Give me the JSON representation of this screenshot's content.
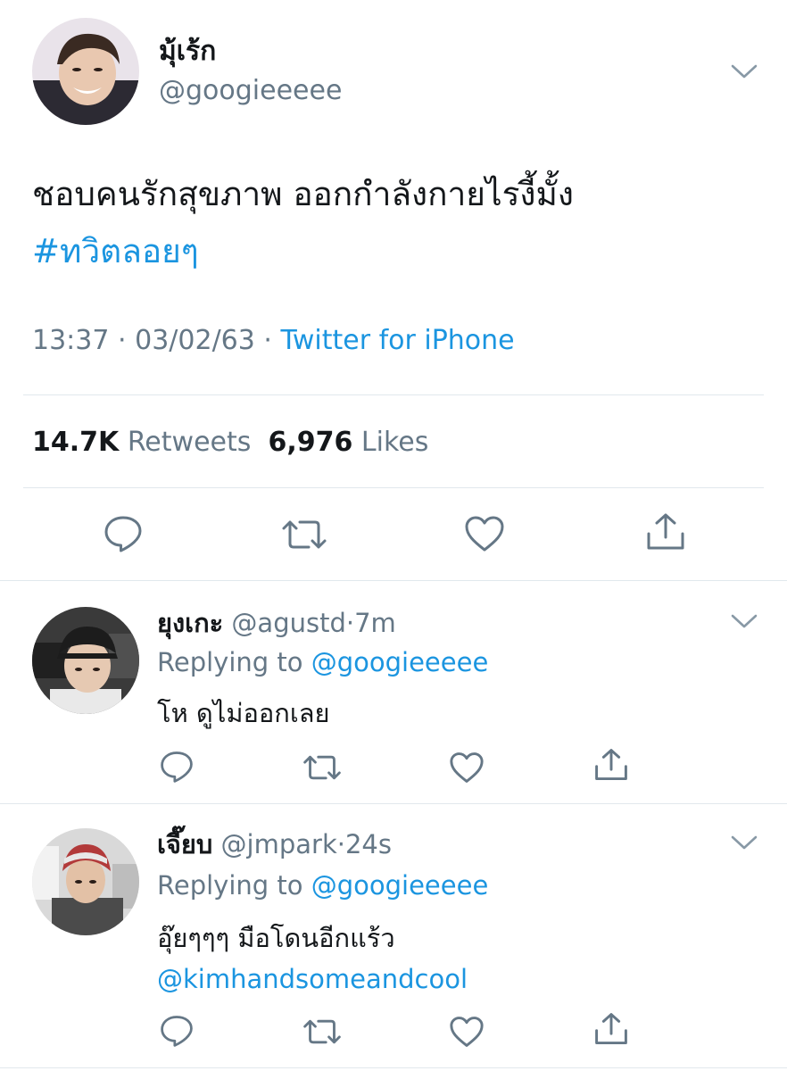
{
  "main_tweet": {
    "author_name": "มุ้เร้ก",
    "author_handle": "@googieeeee",
    "text": "ชอบคนรักสุขภาพ ออกกำลังกายไรงี้มั้ง",
    "hashtag": "#ทวิตลอยๆ",
    "time": "13:37",
    "date": "03/02/63",
    "separator": "·",
    "source": "Twitter for iPhone",
    "retweets_count": "14.7K",
    "retweets_label": "Retweets",
    "likes_count": "6,976",
    "likes_label": "Likes"
  },
  "replies": [
    {
      "name": "ยุงเกะ",
      "handle": "@agustd",
      "separator": "·",
      "time": "7m",
      "replying_label": "Replying to",
      "replying_to": "@googieeeee",
      "text": "โห ดูไม่ออกเลย",
      "mention": ""
    },
    {
      "name": "เจี๊ยบ",
      "handle": "@jmpark",
      "separator": "·",
      "time": "24s",
      "replying_label": "Replying to",
      "replying_to": "@googieeeee",
      "text": "อุ๊ยๆๆๆ มือโดนอีกแร้ว",
      "mention": "@kimhandsomeandcool"
    }
  ],
  "colors": {
    "text": "#14171a",
    "muted": "#657786",
    "link": "#1b95e0",
    "divider": "#e1e8ed"
  },
  "icons": [
    "chevron-down-icon",
    "reply-icon",
    "retweet-icon",
    "like-icon",
    "share-icon"
  ]
}
